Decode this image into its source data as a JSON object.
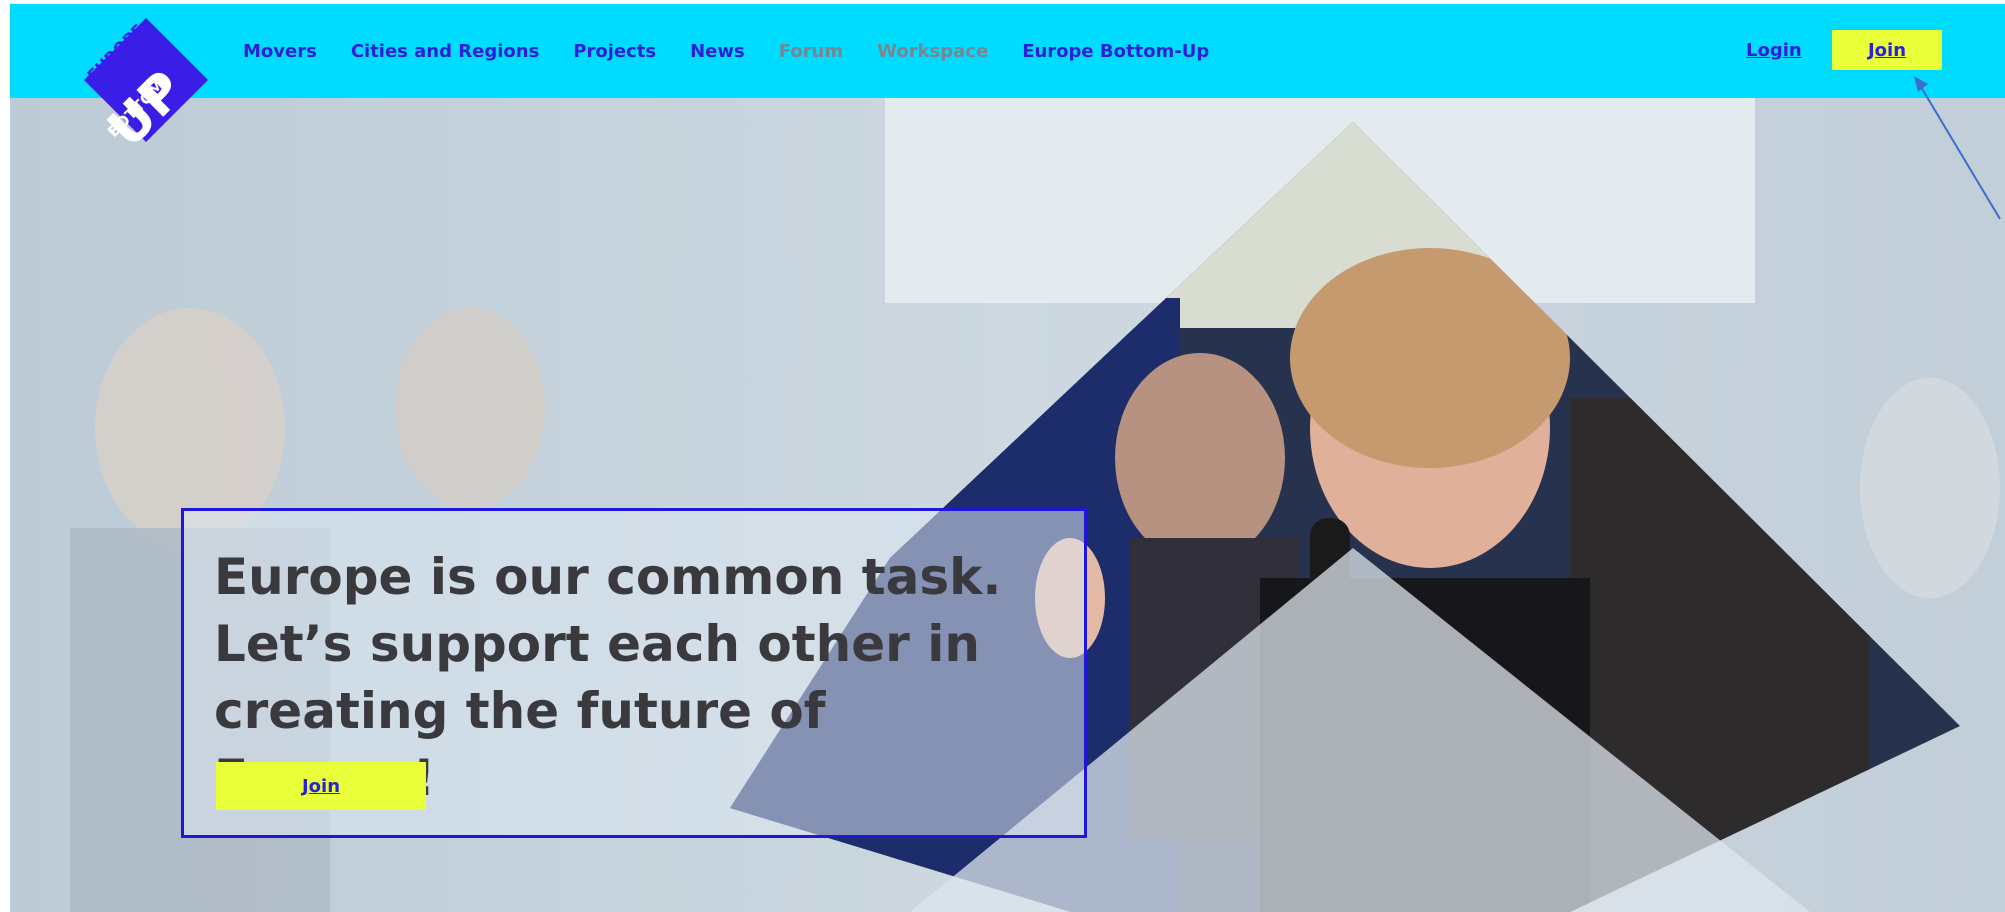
{
  "logo": {
    "top_text": "EUROPE",
    "middle_text": "BOTTOM",
    "bottom_text": "UP"
  },
  "nav": {
    "items": [
      {
        "label": "Movers"
      },
      {
        "label": "Cities and Regions"
      },
      {
        "label": "Projects"
      },
      {
        "label": "News"
      },
      {
        "label": "Forum"
      },
      {
        "label": "Workspace"
      },
      {
        "label": "Europe Bottom-Up"
      }
    ],
    "login_label": "Login",
    "join_label": "Join"
  },
  "hero": {
    "headline": "Europe is our common task. Let’s support each other in creating the future of Europe!",
    "join_label": "Join"
  },
  "colors": {
    "header_bg": "#00dcff",
    "accent_blue": "#2b22d8",
    "button_yellow": "#e8ff3a",
    "muted_nav": "#7a8592"
  }
}
